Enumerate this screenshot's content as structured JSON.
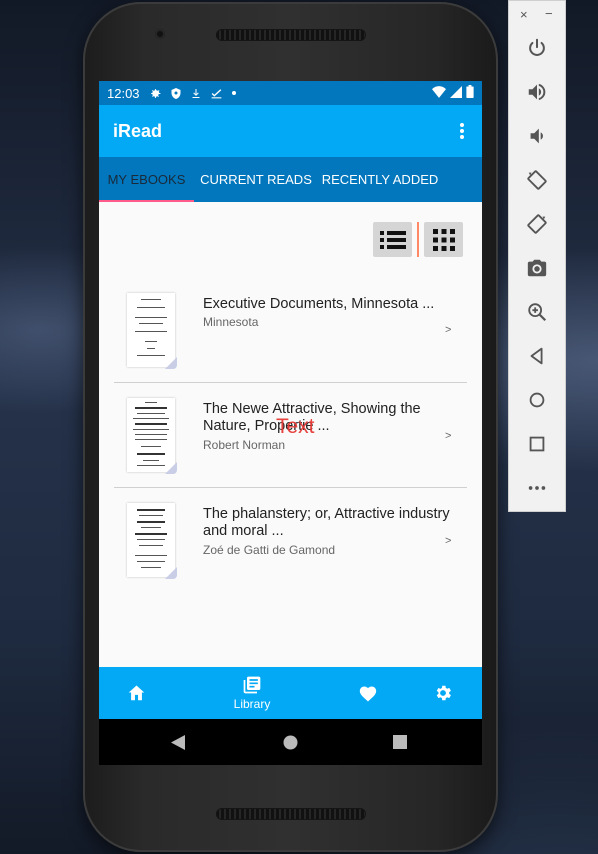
{
  "status_bar": {
    "time": "12:03"
  },
  "app_bar": {
    "title": "iRead"
  },
  "tabs": [
    {
      "label": "MY EBOOKS",
      "active": true
    },
    {
      "label": "CURRENT READS",
      "active": false
    },
    {
      "label": "RECENTLY ADDED",
      "active": false
    }
  ],
  "books": [
    {
      "title": "Executive Documents, Minnesota ...",
      "author": "Minnesota",
      "chevron": ">"
    },
    {
      "title": "The Newe Attractive, Showing the Nature, Propertie ...",
      "author": "Robert Norman",
      "chevron": ">"
    },
    {
      "title": "The phalanstery; or, Attractive industry and moral ...",
      "author": "Zoé de Gatti de Gamond",
      "chevron": ">"
    }
  ],
  "overlay_text": "Text",
  "bottom_nav": {
    "library_label": "Library"
  },
  "emulator_panel": {
    "close": "×",
    "minimize": "−"
  },
  "colors": {
    "status_bar": "#0277bd",
    "app_bar": "#03a9f4",
    "tab_bar": "#0277bd",
    "tab_indicator": "#ff5a8a",
    "overlay_text": "#e53935"
  },
  "icons": {
    "status": [
      "gear-icon",
      "shield-icon",
      "download-icon",
      "checklist-icon",
      "dot-icon"
    ],
    "status_right": [
      "wifi-icon",
      "signal-icon",
      "battery-icon"
    ],
    "app_bar": "more-vert-icon",
    "view_toggle": [
      "list-view-icon",
      "grid-view-icon"
    ],
    "bottom_nav": [
      "home-icon",
      "library-icon",
      "heart-icon",
      "settings-icon"
    ],
    "system_nav": [
      "back-icon",
      "home-circle-icon",
      "recents-icon"
    ],
    "emulator": [
      "power-icon",
      "volume-up-icon",
      "volume-down-icon",
      "rotate-left-icon",
      "rotate-right-icon",
      "camera-icon",
      "zoom-icon",
      "back-icon",
      "home-icon",
      "overview-icon",
      "more-icon"
    ]
  }
}
